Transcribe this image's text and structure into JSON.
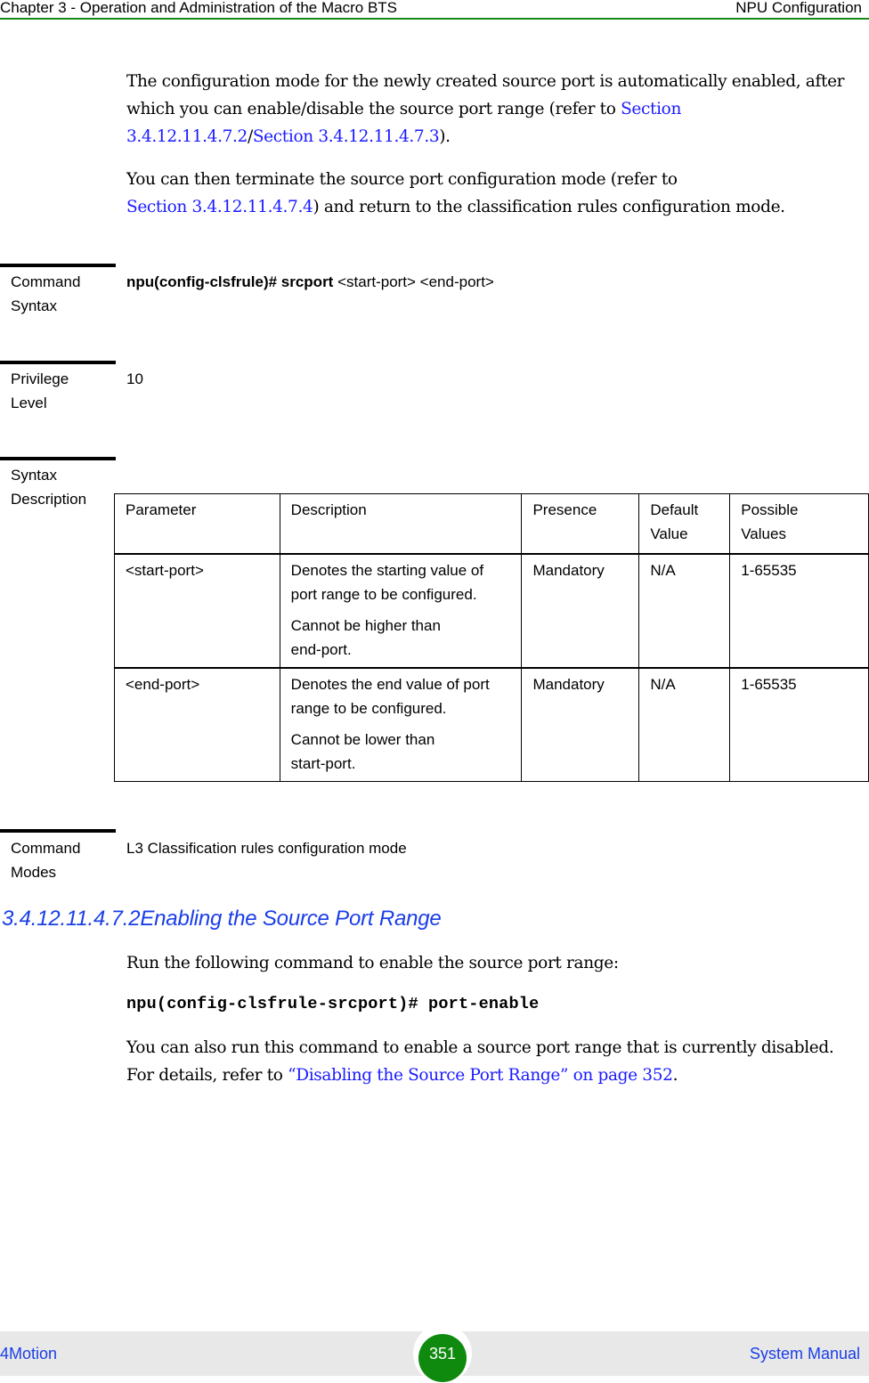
{
  "header": {
    "chapter_title": "Chapter 3 - Operation and Administration of the Macro BTS",
    "section_title": "NPU Configuration",
    "rule_color": "#168a16"
  },
  "intro": {
    "p1_text_a": "The configuration mode for the newly created source port is automatically enabled, after which you can enable/disable the source port range (refer to ",
    "p1_link_1": "Section 3.4.12.11.4.7.2",
    "p1_sep": "/",
    "p1_link_2": "Section 3.4.12.11.4.7.3",
    "p1_text_b": ").",
    "p2_text_a": "You can then terminate the source port configuration mode (refer to ",
    "p2_link": "Section 3.4.12.11.4.7.4",
    "p2_text_b": ") and return to the classification rules configuration mode."
  },
  "command_syntax": {
    "label_line1": "Command",
    "label_line2": "Syntax",
    "command_bold": "npu(config-clsfrule)# srcport",
    "command_args": " <start-port> <end-port>"
  },
  "privilege_level": {
    "label_line1": "Privilege",
    "label_line2": "Level",
    "value": "10"
  },
  "syntax_description": {
    "label_line1": "Syntax",
    "label_line2": "Description",
    "columns": [
      "Parameter",
      "Description",
      "Presence",
      "Default Value",
      "Possible Values"
    ],
    "column_lines": [
      [
        "Parameter"
      ],
      [
        "Description"
      ],
      [
        "Presence"
      ],
      [
        "Default",
        "Value"
      ],
      [
        "Possible",
        "Values"
      ]
    ],
    "rows": [
      {
        "parameter": "<start-port>",
        "description_p1": "Denotes the starting value of port range to be configured.",
        "description_p2": "Cannot be higher than end-port.",
        "presence": "Mandatory",
        "default_value": "N/A",
        "possible_values": "1-65535"
      },
      {
        "parameter": "<end-port>",
        "description_p1": "Denotes the end value of port range to be configured.",
        "description_p2": "Cannot be lower than start-port.",
        "presence": "Mandatory",
        "default_value": "N/A",
        "possible_values": "1-65535"
      }
    ]
  },
  "command_modes": {
    "label_line1": "Command",
    "label_line2": "Modes",
    "value": "L3 Classification rules configuration mode"
  },
  "section": {
    "heading": "3.4.12.11.4.7.2Enabling the Source Port Range",
    "intro": "Run the following command to enable the source port range:",
    "command": "npu(config-clsfrule-srcport)# port-enable",
    "note_text_a": "You can also run this command to enable a source port range that is currently disabled. For details, refer to ",
    "note_link": "“Disabling the Source Port Range” on page 352",
    "note_text_b": "."
  },
  "footer": {
    "product": "4Motion",
    "page_number": "351",
    "manual": "System Manual",
    "badge_color": "#0f8a0f",
    "link_color": "#1a3ee8"
  }
}
